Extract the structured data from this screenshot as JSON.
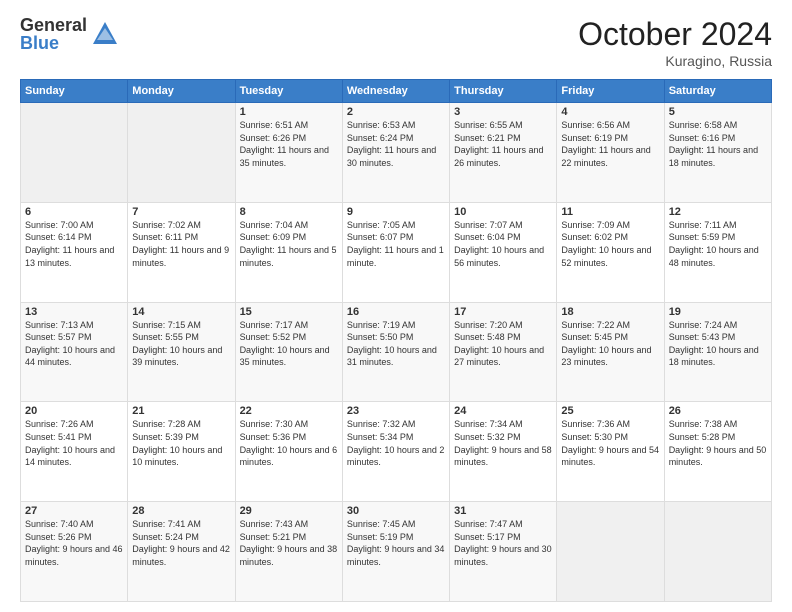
{
  "header": {
    "logo_general": "General",
    "logo_blue": "Blue",
    "month_title": "October 2024",
    "location": "Kuragino, Russia"
  },
  "weekdays": [
    "Sunday",
    "Monday",
    "Tuesday",
    "Wednesday",
    "Thursday",
    "Friday",
    "Saturday"
  ],
  "weeks": [
    [
      {
        "day": "",
        "info": ""
      },
      {
        "day": "",
        "info": ""
      },
      {
        "day": "1",
        "info": "Sunrise: 6:51 AM\nSunset: 6:26 PM\nDaylight: 11 hours\nand 35 minutes."
      },
      {
        "day": "2",
        "info": "Sunrise: 6:53 AM\nSunset: 6:24 PM\nDaylight: 11 hours\nand 30 minutes."
      },
      {
        "day": "3",
        "info": "Sunrise: 6:55 AM\nSunset: 6:21 PM\nDaylight: 11 hours\nand 26 minutes."
      },
      {
        "day": "4",
        "info": "Sunrise: 6:56 AM\nSunset: 6:19 PM\nDaylight: 11 hours\nand 22 minutes."
      },
      {
        "day": "5",
        "info": "Sunrise: 6:58 AM\nSunset: 6:16 PM\nDaylight: 11 hours\nand 18 minutes."
      }
    ],
    [
      {
        "day": "6",
        "info": "Sunrise: 7:00 AM\nSunset: 6:14 PM\nDaylight: 11 hours\nand 13 minutes."
      },
      {
        "day": "7",
        "info": "Sunrise: 7:02 AM\nSunset: 6:11 PM\nDaylight: 11 hours\nand 9 minutes."
      },
      {
        "day": "8",
        "info": "Sunrise: 7:04 AM\nSunset: 6:09 PM\nDaylight: 11 hours\nand 5 minutes."
      },
      {
        "day": "9",
        "info": "Sunrise: 7:05 AM\nSunset: 6:07 PM\nDaylight: 11 hours\nand 1 minute."
      },
      {
        "day": "10",
        "info": "Sunrise: 7:07 AM\nSunset: 6:04 PM\nDaylight: 10 hours\nand 56 minutes."
      },
      {
        "day": "11",
        "info": "Sunrise: 7:09 AM\nSunset: 6:02 PM\nDaylight: 10 hours\nand 52 minutes."
      },
      {
        "day": "12",
        "info": "Sunrise: 7:11 AM\nSunset: 5:59 PM\nDaylight: 10 hours\nand 48 minutes."
      }
    ],
    [
      {
        "day": "13",
        "info": "Sunrise: 7:13 AM\nSunset: 5:57 PM\nDaylight: 10 hours\nand 44 minutes."
      },
      {
        "day": "14",
        "info": "Sunrise: 7:15 AM\nSunset: 5:55 PM\nDaylight: 10 hours\nand 39 minutes."
      },
      {
        "day": "15",
        "info": "Sunrise: 7:17 AM\nSunset: 5:52 PM\nDaylight: 10 hours\nand 35 minutes."
      },
      {
        "day": "16",
        "info": "Sunrise: 7:19 AM\nSunset: 5:50 PM\nDaylight: 10 hours\nand 31 minutes."
      },
      {
        "day": "17",
        "info": "Sunrise: 7:20 AM\nSunset: 5:48 PM\nDaylight: 10 hours\nand 27 minutes."
      },
      {
        "day": "18",
        "info": "Sunrise: 7:22 AM\nSunset: 5:45 PM\nDaylight: 10 hours\nand 23 minutes."
      },
      {
        "day": "19",
        "info": "Sunrise: 7:24 AM\nSunset: 5:43 PM\nDaylight: 10 hours\nand 18 minutes."
      }
    ],
    [
      {
        "day": "20",
        "info": "Sunrise: 7:26 AM\nSunset: 5:41 PM\nDaylight: 10 hours\nand 14 minutes."
      },
      {
        "day": "21",
        "info": "Sunrise: 7:28 AM\nSunset: 5:39 PM\nDaylight: 10 hours\nand 10 minutes."
      },
      {
        "day": "22",
        "info": "Sunrise: 7:30 AM\nSunset: 5:36 PM\nDaylight: 10 hours\nand 6 minutes."
      },
      {
        "day": "23",
        "info": "Sunrise: 7:32 AM\nSunset: 5:34 PM\nDaylight: 10 hours\nand 2 minutes."
      },
      {
        "day": "24",
        "info": "Sunrise: 7:34 AM\nSunset: 5:32 PM\nDaylight: 9 hours\nand 58 minutes."
      },
      {
        "day": "25",
        "info": "Sunrise: 7:36 AM\nSunset: 5:30 PM\nDaylight: 9 hours\nand 54 minutes."
      },
      {
        "day": "26",
        "info": "Sunrise: 7:38 AM\nSunset: 5:28 PM\nDaylight: 9 hours\nand 50 minutes."
      }
    ],
    [
      {
        "day": "27",
        "info": "Sunrise: 7:40 AM\nSunset: 5:26 PM\nDaylight: 9 hours\nand 46 minutes."
      },
      {
        "day": "28",
        "info": "Sunrise: 7:41 AM\nSunset: 5:24 PM\nDaylight: 9 hours\nand 42 minutes."
      },
      {
        "day": "29",
        "info": "Sunrise: 7:43 AM\nSunset: 5:21 PM\nDaylight: 9 hours\nand 38 minutes."
      },
      {
        "day": "30",
        "info": "Sunrise: 7:45 AM\nSunset: 5:19 PM\nDaylight: 9 hours\nand 34 minutes."
      },
      {
        "day": "31",
        "info": "Sunrise: 7:47 AM\nSunset: 5:17 PM\nDaylight: 9 hours\nand 30 minutes."
      },
      {
        "day": "",
        "info": ""
      },
      {
        "day": "",
        "info": ""
      }
    ]
  ]
}
